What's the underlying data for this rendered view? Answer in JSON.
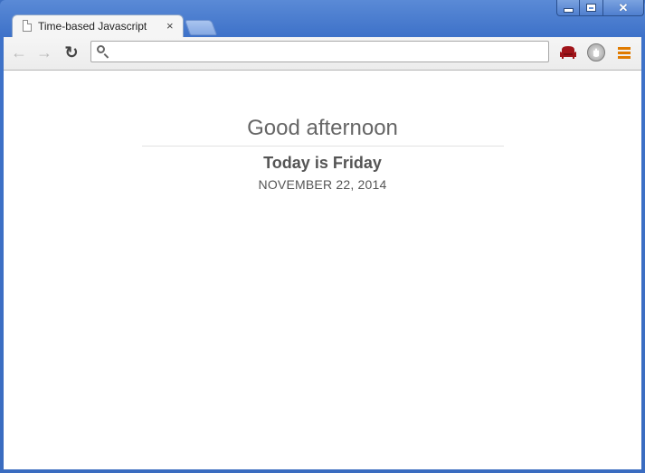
{
  "window": {
    "minimize_icon": "minimize-icon",
    "maximize_icon": "maximize-icon",
    "close_glyph": "✕"
  },
  "tabs": [
    {
      "title": "Time-based Javascript",
      "icon": "page-icon",
      "close_glyph": "×"
    }
  ],
  "toolbar": {
    "back_glyph": "←",
    "forward_glyph": "→",
    "reload_glyph": "↻",
    "omnibox": {
      "value": "",
      "placeholder": ""
    },
    "extensions": [
      "armchair-extension-icon",
      "shield-extension-icon"
    ],
    "menu_icon": "hamburger-menu-icon"
  },
  "page": {
    "greeting": "Good afternoon",
    "today": "Today is Friday",
    "date": "NOVEMBER 22, 2014"
  },
  "colors": {
    "frame_blue": "#3e72c9",
    "menu_orange": "#e07b00",
    "armchair_red": "#a0141a",
    "text_gray": "#666666"
  }
}
